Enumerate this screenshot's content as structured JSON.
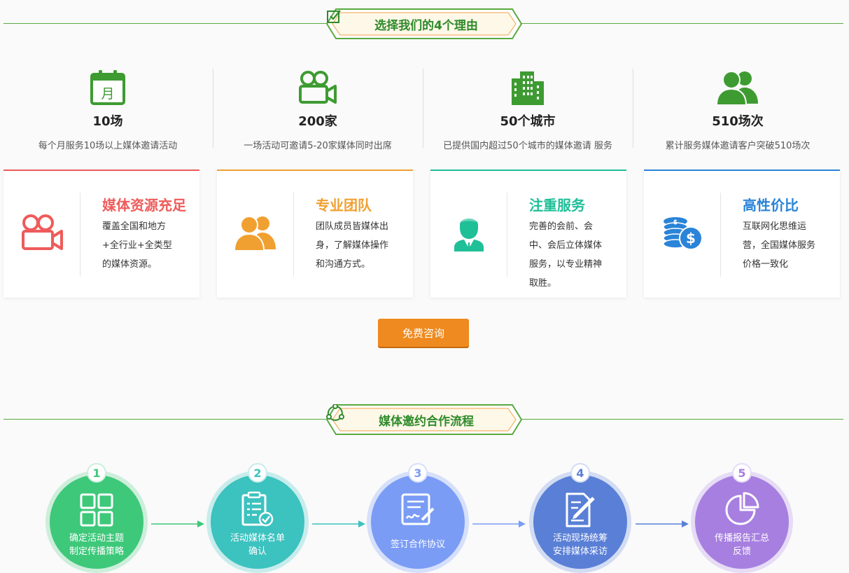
{
  "section1": {
    "title": "选择我们的4个理由",
    "icon": "check-box-icon"
  },
  "stats": [
    {
      "icon": "calendar-icon",
      "icon_text": "月",
      "number": "10场",
      "desc": "每个月服务10场以上媒体邀请活动"
    },
    {
      "icon": "video-camera-icon",
      "number": "200家",
      "desc": "一场活动可邀请5-20家媒体同时出席"
    },
    {
      "icon": "buildings-icon",
      "number": "50个城市",
      "desc": "已提供国内超过50个城市的媒体邀请 服务"
    },
    {
      "icon": "users-icon",
      "number": "510场次",
      "desc": "累计服务媒体邀请客户突破510场次"
    }
  ],
  "features": [
    {
      "icon": "video-camera-icon",
      "title": "媒体资源充足",
      "color": "#ef5b5b",
      "lines": [
        "覆盖全国和地方",
        "+全行业+全类型",
        "的媒体资源。"
      ]
    },
    {
      "icon": "team-icon",
      "title": "专业团队",
      "color": "#f0a030",
      "lines": [
        "团队成员皆媒体出",
        "身，了解媒体操作",
        "和沟通方式。"
      ]
    },
    {
      "icon": "service-person-icon",
      "title": "注重服务",
      "color": "#1fbf98",
      "lines": [
        "完善的会前、会",
        "中、会后立体媒体",
        "服务，以专业精神",
        "取胜。"
      ]
    },
    {
      "icon": "coins-dollar-icon",
      "title": "高性价比",
      "color": "#2a84d8",
      "lines": [
        "互联网化思维运",
        "营，全国媒体服务",
        "价格一致化"
      ]
    }
  ],
  "cta": {
    "label": "免费咨询",
    "color": "#ee8a1f"
  },
  "section2": {
    "title": "媒体邀约合作流程",
    "icon": "process-cycle-icon"
  },
  "steps": [
    {
      "num": "1",
      "icon": "grid-icon",
      "lines": [
        "确定活动主题",
        "制定传播策略"
      ],
      "color": "#3ec87a",
      "ring": "#cdeedb"
    },
    {
      "num": "2",
      "icon": "clipboard-check-icon",
      "lines": [
        "活动媒体名单",
        "确认"
      ],
      "color": "#3cc2bf",
      "ring": "#c8ecec"
    },
    {
      "num": "3",
      "icon": "sign-document-icon",
      "lines": [
        "签订合作协议"
      ],
      "color": "#7a9cf5",
      "ring": "#d6e0fb"
    },
    {
      "num": "4",
      "icon": "edit-document-icon",
      "lines": [
        "活动现场统筹",
        "安排媒体采访"
      ],
      "color": "#5a7fd6",
      "ring": "#d2dcf3"
    },
    {
      "num": "5",
      "icon": "pie-chart-icon",
      "lines": [
        "传播报告汇总",
        "反馈"
      ],
      "color": "#a77fe0",
      "ring": "#e6dcf6"
    }
  ]
}
